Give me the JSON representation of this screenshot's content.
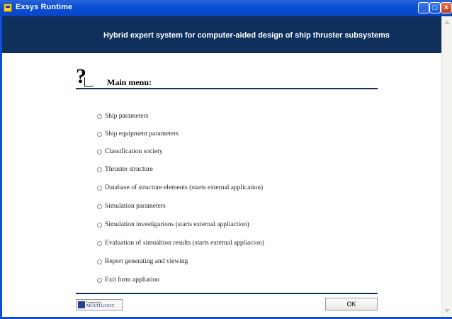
{
  "window": {
    "title": "Exsys Runtime"
  },
  "header": {
    "subtitle": "Hybrid expert system for computer-aided design of ship thruster subsystems"
  },
  "menu": {
    "title": "Main menu:",
    "options": [
      {
        "label": "Ship parameters"
      },
      {
        "label": "Ship equipment parameters"
      },
      {
        "label": "Classification society"
      },
      {
        "label": "Thruster structure"
      },
      {
        "label": "Database of structure elements (starts external application)"
      },
      {
        "label": "Simulation parameters"
      },
      {
        "label": "Simulation investigarions (starts external appliaction)"
      },
      {
        "label": "Evaluation of simualtion results (starts external appliacion)"
      },
      {
        "label": "Report generating and viewing"
      },
      {
        "label": "Exit form appliation"
      }
    ]
  },
  "footer": {
    "powered_by": "Powered by",
    "vendor": "MULTILOGIC",
    "ok_label": "OK"
  },
  "colors": {
    "banner": "#0f2f5c",
    "titlebar": "#0a4fd6"
  },
  "icons": {
    "app": "exsys-app-icon",
    "help": "question-mark-icon"
  }
}
